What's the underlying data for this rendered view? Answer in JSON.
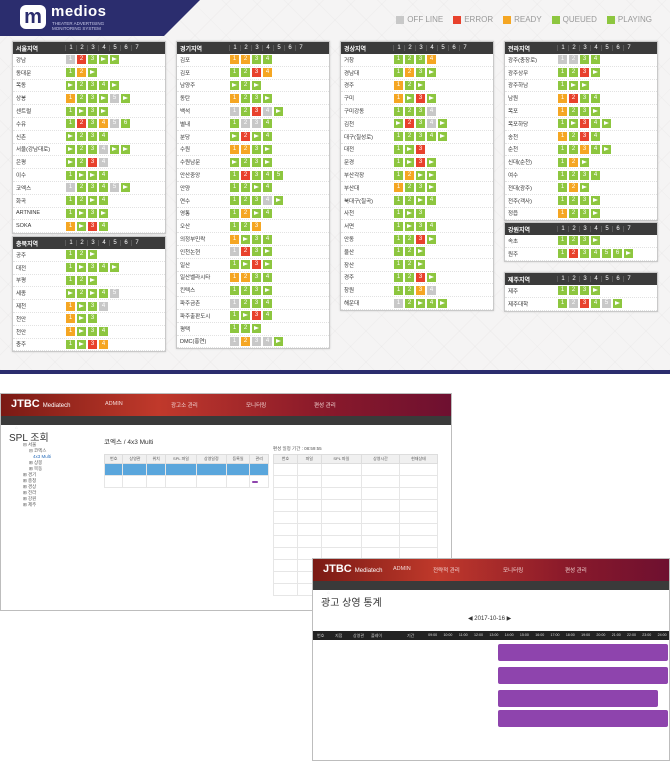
{
  "brand": {
    "name": "medios",
    "tagline": "THEATER ADVERTISING MONITORING SYSTEM"
  },
  "legend": [
    {
      "label": "OFF LINE",
      "color": "#c8c8c8"
    },
    {
      "label": "ERROR",
      "color": "#e8412c"
    },
    {
      "label": "READY",
      "color": "#f5a623"
    },
    {
      "label": "QUEUED",
      "color": "#8dc63f"
    },
    {
      "label": "PLAYING",
      "color": "#8dc63f"
    }
  ],
  "screens": [
    "1",
    "2",
    "3",
    "4",
    "5",
    "6",
    "7"
  ],
  "panels": [
    {
      "title": "서울지역",
      "rows": [
        {
          "name": "강남",
          "cells": [
            "s1",
            "r2",
            "g3",
            "p",
            "p",
            "",
            ""
          ]
        },
        {
          "name": "동대문",
          "cells": [
            "g1",
            "y2",
            "p",
            "",
            "",
            "",
            ""
          ]
        },
        {
          "name": "목동",
          "cells": [
            "p",
            "g2",
            "g3",
            "g4",
            "p",
            "",
            ""
          ]
        },
        {
          "name": "상봉",
          "cells": [
            "y1",
            "g2",
            "g3",
            "p",
            "s5",
            "p",
            ""
          ]
        },
        {
          "name": "센트럴",
          "cells": [
            "g1",
            "p",
            "g3",
            "p",
            "",
            "",
            ""
          ]
        },
        {
          "name": "수유",
          "cells": [
            "g1",
            "r2",
            "g3",
            "y4",
            "s5",
            "g6",
            ""
          ]
        },
        {
          "name": "신촌",
          "cells": [
            "p",
            "g2",
            "g3",
            "g4",
            "",
            "",
            ""
          ]
        },
        {
          "name": "서울(강남대로)",
          "cells": [
            "p",
            "g2",
            "g3",
            "s4",
            "p",
            "p",
            ""
          ]
        },
        {
          "name": "은평",
          "cells": [
            "p",
            "g2",
            "r3",
            "s4",
            "",
            "",
            ""
          ]
        },
        {
          "name": "이수",
          "cells": [
            "g1",
            "p",
            "p",
            "g4",
            "",
            "",
            ""
          ]
        },
        {
          "name": "코엑스",
          "cells": [
            "s1",
            "g2",
            "g3",
            "g4",
            "s5",
            "p",
            ""
          ]
        },
        {
          "name": "화곡",
          "cells": [
            "g1",
            "g2",
            "p",
            "g4",
            "",
            "",
            ""
          ]
        },
        {
          "name": "ARTNINE",
          "cells": [
            "g1",
            "p",
            "g3",
            "p",
            "",
            "",
            ""
          ]
        },
        {
          "name": "SOKA",
          "cells": [
            "y1",
            "p",
            "r3",
            "g4",
            "",
            "",
            ""
          ]
        }
      ]
    },
    {
      "title": "충북지역",
      "rows": [
        {
          "name": "공주",
          "cells": [
            "g1",
            "g2",
            "p",
            "",
            "",
            "",
            ""
          ]
        },
        {
          "name": "대전",
          "cells": [
            "g1",
            "p",
            "g3",
            "g4",
            "p",
            "",
            ""
          ]
        },
        {
          "name": "부평",
          "cells": [
            "g1",
            "g2",
            "p",
            "",
            "",
            "",
            ""
          ]
        },
        {
          "name": "세종",
          "cells": [
            "p",
            "g2",
            "p",
            "g4",
            "s5",
            "",
            ""
          ]
        },
        {
          "name": "제천",
          "cells": [
            "y1",
            "p",
            "g3",
            "s4",
            "",
            "",
            ""
          ]
        },
        {
          "name": "천안",
          "cells": [
            "y1",
            "p",
            "g3",
            "",
            "",
            "",
            ""
          ]
        },
        {
          "name": "천안",
          "cells": [
            "y1",
            "p",
            "g3",
            "g4",
            "",
            "",
            ""
          ]
        },
        {
          "name": "충주",
          "cells": [
            "g1",
            "p",
            "r3",
            "y4",
            "",
            "",
            ""
          ]
        }
      ]
    },
    {
      "title": "경기지역",
      "rows": [
        {
          "name": "김포",
          "cells": [
            "y1",
            "y2",
            "g3",
            "g4",
            "",
            "",
            ""
          ]
        },
        {
          "name": "김포",
          "cells": [
            "g1",
            "g2",
            "r3",
            "y4",
            "",
            "",
            ""
          ]
        },
        {
          "name": "남양주",
          "cells": [
            "p",
            "g2",
            "p",
            "",
            "",
            "",
            ""
          ]
        },
        {
          "name": "동탄",
          "cells": [
            "y1",
            "g2",
            "g3",
            "p",
            "",
            "",
            ""
          ]
        },
        {
          "name": "백석",
          "cells": [
            "s1",
            "g2",
            "r3",
            "s4",
            "p",
            "",
            ""
          ]
        },
        {
          "name": "별내",
          "cells": [
            "g1",
            "s2",
            "s3",
            "g4",
            "",
            "",
            ""
          ]
        },
        {
          "name": "분당",
          "cells": [
            "p",
            "r2",
            "p",
            "g4",
            "",
            "",
            ""
          ]
        },
        {
          "name": "수원",
          "cells": [
            "y1",
            "y2",
            "g3",
            "p",
            "",
            "",
            ""
          ]
        },
        {
          "name": "수원남문",
          "cells": [
            "p",
            "g2",
            "g3",
            "p",
            "",
            "",
            ""
          ]
        },
        {
          "name": "안산중앙",
          "cells": [
            "g1",
            "r2",
            "g3",
            "g4",
            "g5",
            "",
            ""
          ]
        },
        {
          "name": "안양",
          "cells": [
            "g1",
            "g2",
            "p",
            "g4",
            "",
            "",
            ""
          ]
        },
        {
          "name": "연수",
          "cells": [
            "g1",
            "g2",
            "g3",
            "s4",
            "p",
            "",
            ""
          ]
        },
        {
          "name": "영통",
          "cells": [
            "g1",
            "y2",
            "p",
            "g4",
            "",
            "",
            ""
          ]
        },
        {
          "name": "오산",
          "cells": [
            "g1",
            "g2",
            "y3",
            "",
            "",
            "",
            ""
          ]
        },
        {
          "name": "의정부민락",
          "cells": [
            "y1",
            "p",
            "g3",
            "g4",
            "",
            "",
            ""
          ]
        },
        {
          "name": "인천논현",
          "cells": [
            "s1",
            "r2",
            "g3",
            "p",
            "",
            "",
            ""
          ]
        },
        {
          "name": "일산",
          "cells": [
            "g1",
            "p",
            "r3",
            "p",
            "",
            "",
            ""
          ]
        },
        {
          "name": "일산벨라시타",
          "cells": [
            "y1",
            "y2",
            "g3",
            "g4",
            "",
            "",
            ""
          ]
        },
        {
          "name": "킨텍스",
          "cells": [
            "g1",
            "g2",
            "g3",
            "p",
            "",
            "",
            ""
          ]
        },
        {
          "name": "파주금촌",
          "cells": [
            "s1",
            "g2",
            "g3",
            "g4",
            "",
            "",
            ""
          ]
        },
        {
          "name": "파주출판도시",
          "cells": [
            "g1",
            "p",
            "r3",
            "g4",
            "",
            "",
            ""
          ]
        },
        {
          "name": "평택",
          "cells": [
            "g1",
            "g2",
            "p",
            "",
            "",
            "",
            ""
          ]
        },
        {
          "name": "DMC(홍연)",
          "cells": [
            "s1",
            "y2",
            "s3",
            "s4",
            "p",
            "",
            ""
          ]
        }
      ]
    },
    {
      "title": "경상지역",
      "rows": [
        {
          "name": "거창",
          "cells": [
            "g1",
            "g2",
            "g3",
            "y4",
            "",
            "",
            ""
          ]
        },
        {
          "name": "경남대",
          "cells": [
            "g1",
            "y2",
            "g3",
            "p",
            "",
            "",
            ""
          ]
        },
        {
          "name": "경주",
          "cells": [
            "y1",
            "g2",
            "p",
            "",
            "",
            "",
            ""
          ]
        },
        {
          "name": "구미",
          "cells": [
            "y1",
            "p",
            "r3",
            "p",
            "",
            "",
            ""
          ]
        },
        {
          "name": "구미강동",
          "cells": [
            "g1",
            "g2",
            "g3",
            "s4",
            "",
            "",
            ""
          ]
        },
        {
          "name": "김천",
          "cells": [
            "p",
            "r2",
            "g3",
            "s4",
            "p",
            "",
            ""
          ]
        },
        {
          "name": "대구(칠성로)",
          "cells": [
            "g1",
            "g2",
            "g3",
            "g4",
            "p",
            "",
            ""
          ]
        },
        {
          "name": "대전",
          "cells": [
            "g1",
            "p",
            "r3",
            "",
            "",
            "",
            ""
          ]
        },
        {
          "name": "문경",
          "cells": [
            "g1",
            "p",
            "r3",
            "p",
            "",
            "",
            ""
          ]
        },
        {
          "name": "부산각장",
          "cells": [
            "g1",
            "y2",
            "p",
            "p",
            "",
            "",
            ""
          ]
        },
        {
          "name": "부산대",
          "cells": [
            "y1",
            "g2",
            "g3",
            "p",
            "",
            "",
            ""
          ]
        },
        {
          "name": "북대구(칠곡)",
          "cells": [
            "g1",
            "g2",
            "p",
            "g4",
            "",
            "",
            ""
          ]
        },
        {
          "name": "사천",
          "cells": [
            "g1",
            "p",
            "g3",
            "",
            "",
            "",
            ""
          ]
        },
        {
          "name": "서면",
          "cells": [
            "g1",
            "p",
            "g3",
            "g4",
            "",
            "",
            ""
          ]
        },
        {
          "name": "안동",
          "cells": [
            "g1",
            "g2",
            "r3",
            "p",
            "",
            "",
            ""
          ]
        },
        {
          "name": "울산",
          "cells": [
            "g1",
            "g2",
            "p",
            "",
            "",
            "",
            ""
          ]
        },
        {
          "name": "장산",
          "cells": [
            "g1",
            "g2",
            "p",
            "",
            "",
            "",
            ""
          ]
        },
        {
          "name": "경주",
          "cells": [
            "g1",
            "g2",
            "r3",
            "p",
            "",
            "",
            ""
          ]
        },
        {
          "name": "창원",
          "cells": [
            "g1",
            "g2",
            "y3",
            "s4",
            "",
            "",
            ""
          ]
        },
        {
          "name": "해운대",
          "cells": [
            "s1",
            "g2",
            "p",
            "g4",
            "p",
            "",
            ""
          ]
        }
      ]
    },
    {
      "title": "전라지역",
      "rows": [
        {
          "name": "광주(충장로)",
          "cells": [
            "s1",
            "s2",
            "g3",
            "g4",
            "",
            "",
            ""
          ]
        },
        {
          "name": "광주상무",
          "cells": [
            "g1",
            "g2",
            "r3",
            "p",
            "",
            "",
            ""
          ]
        },
        {
          "name": "광주하남",
          "cells": [
            "g1",
            "p",
            "p",
            "",
            "",
            "",
            ""
          ]
        },
        {
          "name": "남원",
          "cells": [
            "y1",
            "r2",
            "g3",
            "g4",
            "",
            "",
            ""
          ]
        },
        {
          "name": "목포",
          "cells": [
            "y1",
            "g2",
            "g3",
            "p",
            "",
            "",
            ""
          ]
        },
        {
          "name": "목포하당",
          "cells": [
            "g1",
            "p",
            "r3",
            "g4",
            "p",
            "",
            ""
          ]
        },
        {
          "name": "송천",
          "cells": [
            "y1",
            "g2",
            "r3",
            "g4",
            "",
            "",
            ""
          ]
        },
        {
          "name": "순천",
          "cells": [
            "g1",
            "g2",
            "y3",
            "g4",
            "p",
            "",
            ""
          ]
        },
        {
          "name": "신대(순천)",
          "cells": [
            "g1",
            "y2",
            "p",
            "",
            "",
            "",
            ""
          ]
        },
        {
          "name": "여수",
          "cells": [
            "g1",
            "g2",
            "g3",
            "g4",
            "",
            "",
            ""
          ]
        },
        {
          "name": "전대(광주)",
          "cells": [
            "g1",
            "y2",
            "p",
            "",
            "",
            "",
            ""
          ]
        },
        {
          "name": "전주(객사)",
          "cells": [
            "g1",
            "g2",
            "g3",
            "p",
            "",
            "",
            ""
          ]
        },
        {
          "name": "정읍",
          "cells": [
            "y1",
            "g2",
            "g3",
            "p",
            "",
            "",
            ""
          ]
        }
      ]
    },
    {
      "title": "강원지역",
      "rows": [
        {
          "name": "속초",
          "cells": [
            "g1",
            "g2",
            "g3",
            "p",
            "",
            "",
            ""
          ]
        },
        {
          "name": "원주",
          "cells": [
            "g1",
            "r2",
            "g3",
            "g4",
            "g5",
            "g6",
            "p"
          ]
        }
      ]
    },
    {
      "title": "제주지역",
      "rows": [
        {
          "name": "제주",
          "cells": [
            "g1",
            "g2",
            "g3",
            "p",
            "",
            "",
            ""
          ]
        },
        {
          "name": "제주대학",
          "cells": [
            "g1",
            "s2",
            "r3",
            "g4",
            "s5",
            "p",
            ""
          ]
        }
      ]
    }
  ],
  "win1": {
    "brand": "JTBC",
    "brand_sub": "Mediatech",
    "nav": [
      "ADMIN",
      "광고소 관리",
      "모니터링",
      "편성 관리"
    ],
    "title": "SPL 조회",
    "subtitle": "코엑스 / 4x3 Multi",
    "label_date": "편성 일정 기간 : 08:59:55",
    "cols_left": [
      "번호",
      "상영관",
      "위치",
      "SPL 파일",
      "상영일정",
      "등록일",
      "관리"
    ],
    "cols_right": [
      "번호",
      "파일",
      "SPL 파일",
      "상영시간",
      "현재상태"
    ]
  },
  "win2": {
    "brand": "JTBC",
    "brand_sub": "Mediatech",
    "nav": [
      "ADMIN",
      "전략적 관리",
      "모니터링",
      "편성 관리"
    ],
    "title": "광고 상영 통계",
    "date": "2017-10-16",
    "times": [
      "09:00",
      "10:00",
      "11:00",
      "12:00",
      "13:00",
      "14:00",
      "15:00",
      "16:00",
      "17:00",
      "18:00",
      "19:00",
      "20:00",
      "21:00",
      "22:00",
      "23:00",
      "24:00"
    ],
    "cols": [
      "번호",
      "지점",
      "상영관",
      "플레이",
      "",
      "기간"
    ]
  }
}
